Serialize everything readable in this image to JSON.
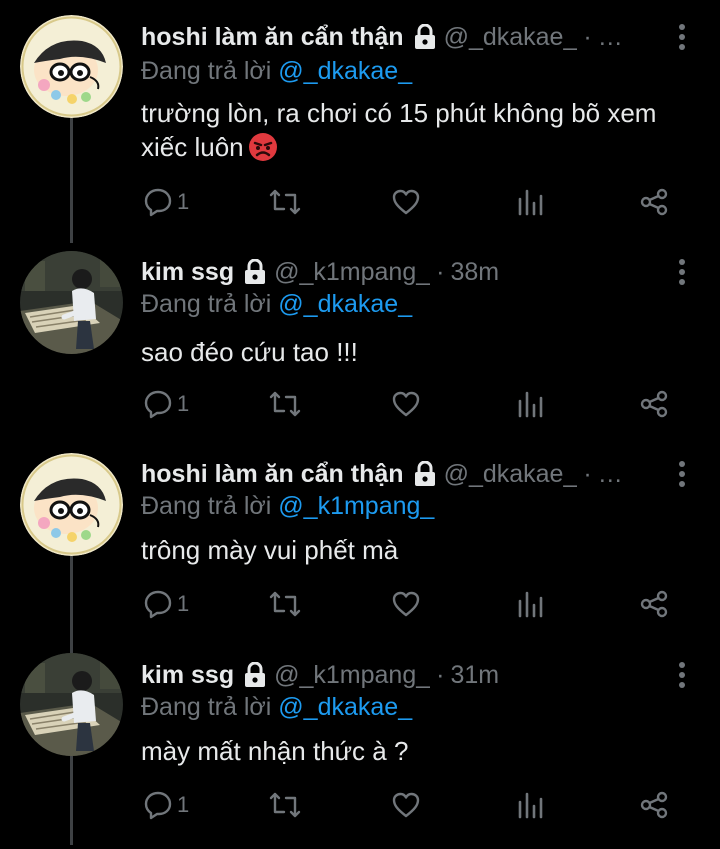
{
  "tweets": [
    {
      "display_name": "hoshi làm ăn cẩn thận",
      "handle": "@_dkakae_",
      "separator": "·",
      "time": "…",
      "replying_prefix": "Đang trả lời",
      "replying_to": "@_dkakae_",
      "text": "trường lòn, ra chơi có 15 phút không bõ xem xiếc luôn",
      "emoji": "angry-face-emoji",
      "reply_count": "1",
      "avatar": "shinchan-avatar"
    },
    {
      "display_name": "kim ssg",
      "handle": "@_k1mpang_",
      "separator": "·",
      "time": "38m",
      "replying_prefix": "Đang trả lời",
      "replying_to": "@_dkakae_",
      "text": "sao đéo cứu tao !!!",
      "reply_count": "1",
      "avatar": "ghibli-boy-avatar"
    },
    {
      "display_name": "hoshi làm ăn cẩn thận",
      "handle": "@_dkakae_",
      "separator": "·",
      "time": "…",
      "replying_prefix": "Đang trả lời",
      "replying_to": "@_k1mpang_",
      "text": "trông mày vui phết mà",
      "reply_count": "1",
      "avatar": "shinchan-avatar"
    },
    {
      "display_name": "kim ssg",
      "handle": "@_k1mpang_",
      "separator": "·",
      "time": "31m",
      "replying_prefix": "Đang trả lời",
      "replying_to": "@_dkakae_",
      "text": "mày mất nhận thức à ?",
      "reply_count": "1",
      "avatar": "ghibli-boy-avatar"
    }
  ],
  "colors": {
    "background": "#000000",
    "text_primary": "#e7e9ea",
    "text_secondary": "#71767b",
    "accent": "#1d9bf0",
    "thread_line": "#3e4144"
  }
}
